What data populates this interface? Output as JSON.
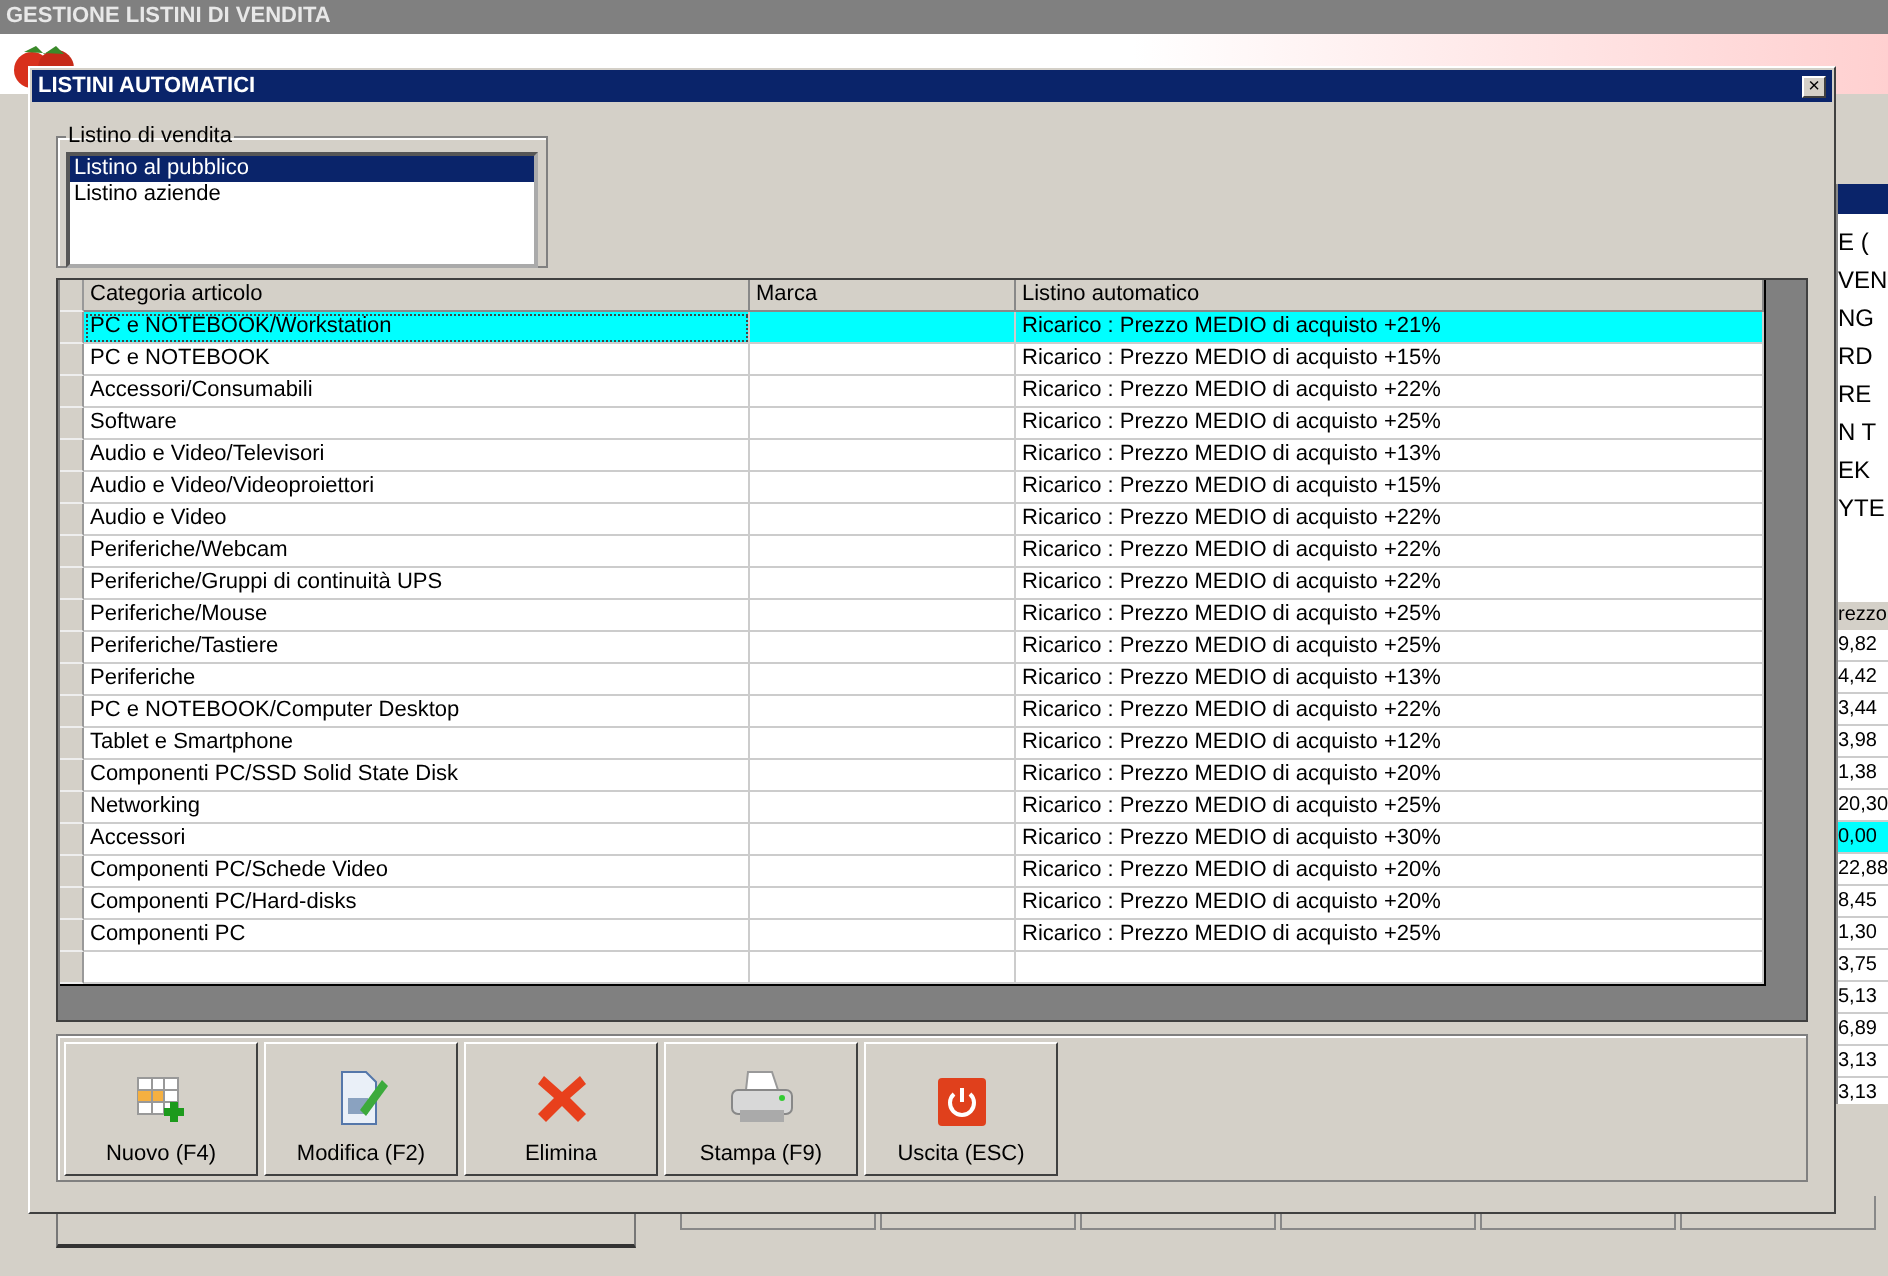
{
  "background_window": {
    "title": "GESTIONE LISTINI DI VENDITA",
    "side_lines": [
      "E (",
      "VEN",
      "NG",
      "RD",
      "RE",
      "N T",
      "EK",
      "YTE"
    ],
    "price_column": {
      "heading": "rezzo",
      "cells": [
        {
          "text": "9,82",
          "selected": false
        },
        {
          "text": "4,42",
          "selected": false
        },
        {
          "text": "3,44",
          "selected": false
        },
        {
          "text": "3,98",
          "selected": false
        },
        {
          "text": "1,38",
          "selected": false
        },
        {
          "text": "20,30",
          "selected": false
        },
        {
          "text": "0,00",
          "selected": true
        },
        {
          "text": "22,88",
          "selected": false
        },
        {
          "text": "8,45",
          "selected": false
        },
        {
          "text": "1,30",
          "selected": false
        },
        {
          "text": "3,75",
          "selected": false
        },
        {
          "text": "5,13",
          "selected": false
        },
        {
          "text": "6,89",
          "selected": false
        },
        {
          "text": "3,13",
          "selected": false
        },
        {
          "text": "3,13",
          "selected": false
        }
      ]
    }
  },
  "dialog": {
    "title": "LISTINI AUTOMATICI",
    "close": "×",
    "price_lists": {
      "label": "Listino di vendita",
      "items": [
        {
          "text": "Listino al pubblico",
          "selected": true
        },
        {
          "text": "Listino aziende",
          "selected": false
        }
      ]
    },
    "table": {
      "columns": [
        "Categoria articolo",
        "Marca",
        "Listino automatico"
      ],
      "rows": [
        {
          "category": "PC e NOTEBOOK/Workstation",
          "rule": "Ricarico : Prezzo MEDIO di acquisto +21%",
          "selected": true
        },
        {
          "category": "PC e NOTEBOOK",
          "rule": "Ricarico : Prezzo MEDIO di acquisto +15%",
          "selected": false
        },
        {
          "category": "Accessori/Consumabili",
          "rule": "Ricarico : Prezzo MEDIO di acquisto +22%",
          "selected": false
        },
        {
          "category": "Software",
          "rule": "Ricarico : Prezzo MEDIO di acquisto +25%",
          "selected": false
        },
        {
          "category": "Audio e Video/Televisori",
          "rule": "Ricarico : Prezzo MEDIO di acquisto +13%",
          "selected": false
        },
        {
          "category": "Audio e Video/Videoproiettori",
          "rule": "Ricarico : Prezzo MEDIO di acquisto +15%",
          "selected": false
        },
        {
          "category": "Audio e Video",
          "rule": "Ricarico : Prezzo MEDIO di acquisto +22%",
          "selected": false
        },
        {
          "category": "Periferiche/Webcam",
          "rule": "Ricarico : Prezzo MEDIO di acquisto +22%",
          "selected": false
        },
        {
          "category": "Periferiche/Gruppi di continuità UPS",
          "rule": "Ricarico : Prezzo MEDIO di acquisto +22%",
          "selected": false
        },
        {
          "category": "Periferiche/Mouse",
          "rule": "Ricarico : Prezzo MEDIO di acquisto +25%",
          "selected": false
        },
        {
          "category": "Periferiche/Tastiere",
          "rule": "Ricarico : Prezzo MEDIO di acquisto +25%",
          "selected": false
        },
        {
          "category": "Periferiche",
          "rule": "Ricarico : Prezzo MEDIO di acquisto +13%",
          "selected": false
        },
        {
          "category": "PC e NOTEBOOK/Computer Desktop",
          "rule": "Ricarico : Prezzo MEDIO di acquisto +22%",
          "selected": false
        },
        {
          "category": "Tablet e Smartphone",
          "rule": "Ricarico : Prezzo MEDIO di acquisto +12%",
          "selected": false
        },
        {
          "category": "Componenti PC/SSD Solid State Disk",
          "rule": "Ricarico : Prezzo MEDIO di acquisto +20%",
          "selected": false
        },
        {
          "category": "Networking",
          "rule": "Ricarico : Prezzo MEDIO di acquisto +25%",
          "selected": false
        },
        {
          "category": "Accessori",
          "rule": "Ricarico : Prezzo MEDIO di acquisto +30%",
          "selected": false
        },
        {
          "category": "Componenti PC/Schede Video",
          "rule": "Ricarico : Prezzo MEDIO di acquisto +20%",
          "selected": false
        },
        {
          "category": "Componenti PC/Hard-disks",
          "rule": "Ricarico : Prezzo MEDIO di acquisto +20%",
          "selected": false
        },
        {
          "category": "Componenti PC",
          "rule": "Ricarico : Prezzo MEDIO di acquisto +25%",
          "selected": false
        }
      ]
    },
    "buttons": [
      {
        "kind": "new",
        "label": "Nuovo (F4)"
      },
      {
        "kind": "edit",
        "label": "Modifica (F2)"
      },
      {
        "kind": "delete",
        "label": "Elimina"
      },
      {
        "kind": "print",
        "label": "Stampa (F9)"
      },
      {
        "kind": "exit",
        "label": "Uscita (ESC)"
      }
    ]
  }
}
